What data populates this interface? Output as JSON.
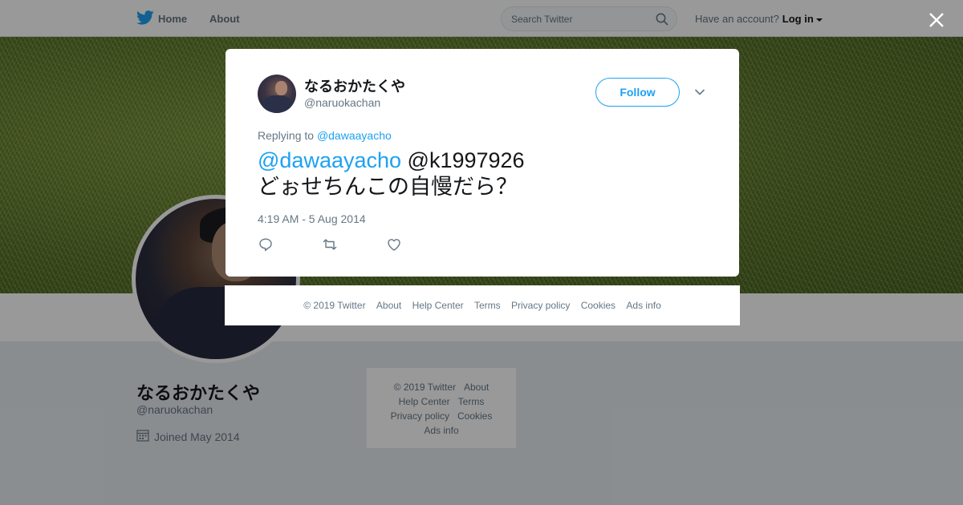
{
  "background": {
    "nav": {
      "home_label": "Home",
      "about_label": "About",
      "search_placeholder": "Search Twitter",
      "account_prompt": "Have an account?",
      "login_label": "Log in"
    },
    "profile": {
      "name": "なるおかたくや",
      "handle": "@naruokachan",
      "joined": "Joined May 2014"
    },
    "footer": {
      "copyright": "© 2019 Twitter",
      "about": "About",
      "help_center": "Help Center",
      "terms": "Terms",
      "privacy": "Privacy policy",
      "cookies": "Cookies",
      "ads_info": "Ads info"
    }
  },
  "tweet": {
    "author_name": "なるおかたくや",
    "author_handle": "@naruokachan",
    "follow_label": "Follow",
    "replying_prefix": "Replying to",
    "replying_to": "@dawaayacho",
    "mention_1": "@dawaayacho",
    "mention_2": "@k1997926",
    "text_line": "どぉせちんこの自慢だら？",
    "timestamp": "4:19 AM - 5 Aug 2014"
  },
  "modal_footer": {
    "copyright": "© 2019 Twitter",
    "about": "About",
    "help_center": "Help Center",
    "terms": "Terms",
    "privacy": "Privacy policy",
    "cookies": "Cookies",
    "ads_info": "Ads info"
  },
  "icons": {
    "brand": "twitter-bird-icon",
    "search": "search-icon",
    "close": "close-icon",
    "chevron": "chevron-down-icon",
    "reply": "reply-icon",
    "retweet": "retweet-icon",
    "like": "heart-icon",
    "calendar": "calendar-icon"
  },
  "colors": {
    "accent": "#1da1f2",
    "text": "#14171a",
    "muted": "#657786",
    "page_bg": "#e6ecf0"
  }
}
